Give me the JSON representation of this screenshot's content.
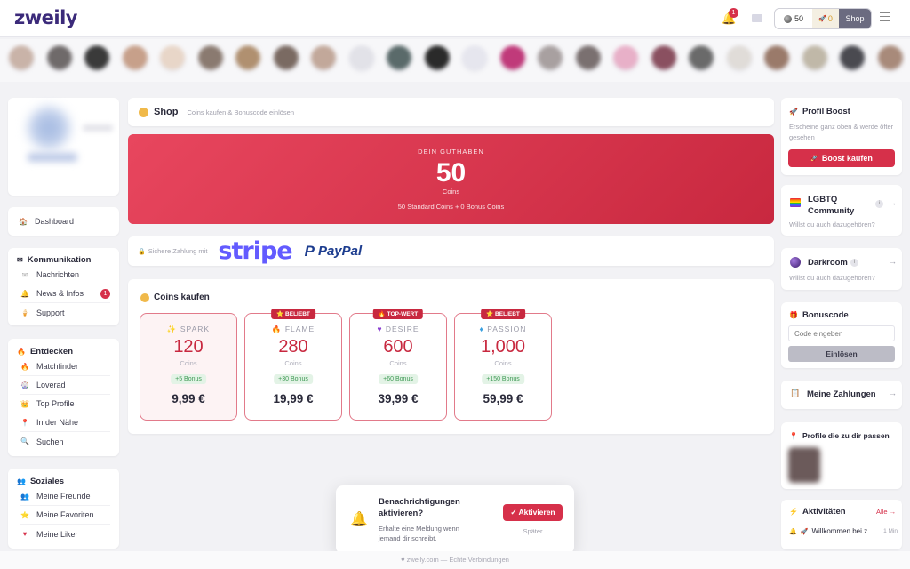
{
  "header": {
    "logo": "zweily",
    "notifications_count": "1",
    "coins": "50",
    "bonus_coins": "0",
    "shop_label": "Shop"
  },
  "left": {
    "dashboard": "Dashboard",
    "kommunikation": {
      "title": "Kommunikation",
      "items": [
        {
          "label": "Nachrichten",
          "icon": "envelope-icon"
        },
        {
          "label": "News & Infos",
          "icon": "bell-icon",
          "badge": "1"
        },
        {
          "label": "Support",
          "icon": "support-icon"
        }
      ]
    },
    "entdecken": {
      "title": "Entdecken",
      "items": [
        {
          "label": "Matchfinder",
          "icon": "flame-icon"
        },
        {
          "label": "Loverad",
          "icon": "wheel-icon"
        },
        {
          "label": "Top Profile",
          "icon": "crown-icon"
        },
        {
          "label": "In der Nähe",
          "icon": "pin-icon"
        },
        {
          "label": "Suchen",
          "icon": "search-icon"
        }
      ]
    },
    "soziales": {
      "title": "Soziales",
      "items": [
        {
          "label": "Meine Freunde",
          "icon": "friends-icon"
        },
        {
          "label": "Meine Favoriten",
          "icon": "star-icon"
        },
        {
          "label": "Meine Liker",
          "icon": "heart-icon"
        }
      ]
    }
  },
  "shop": {
    "title": "Shop",
    "subtitle": "Coins kaufen & Bonuscode einlösen",
    "balance_label": "DEIN GUTHABEN",
    "balance_value": "50",
    "balance_unit": "Coins",
    "balance_detail": "50 Standard Coins + 0 Bonus Coins",
    "secure_payment": "Sichere Zahlung mit",
    "stripe": "stripe",
    "paypal": "PayPal",
    "buy_title": "Coins kaufen",
    "packages": [
      {
        "ribbon": "",
        "name": "SPARK",
        "amount": "120",
        "unit": "Coins",
        "bonus": "+5 Bonus",
        "price": "9,99 €"
      },
      {
        "ribbon": "BELIEBT",
        "name": "FLAME",
        "amount": "280",
        "unit": "Coins",
        "bonus": "+30 Bonus",
        "price": "19,99 €"
      },
      {
        "ribbon": "TOP-WERT",
        "name": "DESIRE",
        "amount": "600",
        "unit": "Coins",
        "bonus": "+60 Bonus",
        "price": "39,99 €"
      },
      {
        "ribbon": "BELIEBT",
        "name": "PASSION",
        "amount": "1,000",
        "unit": "Coins",
        "bonus": "+150 Bonus",
        "price": "59,99 €"
      }
    ]
  },
  "right": {
    "boost": {
      "title": "Profil Boost",
      "desc": "Erscheine ganz oben & werde öfter gesehen",
      "button": "Boost kaufen"
    },
    "lgbtq": {
      "title": "LGBTQ Community",
      "desc": "Willst du auch dazugehören?"
    },
    "darkroom": {
      "title": "Darkroom",
      "desc": "Willst du auch dazugehören?"
    },
    "bonuscode": {
      "title": "Bonuscode",
      "placeholder": "Code eingeben",
      "button": "Einlösen"
    },
    "payments": {
      "title": "Meine Zahlungen"
    },
    "matches": {
      "title": "Profile die zu dir passen"
    },
    "activity": {
      "title": "Aktivitäten",
      "all": "Alle →",
      "item": "Willkommen bei z...",
      "time": "1 Min"
    }
  },
  "toast": {
    "title": "Benachrichtigungen aktivieren?",
    "desc": "Erhalte eine Meldung wenn jemand dir schreibt.",
    "activate": "✓ Aktivieren",
    "later": "Später"
  },
  "footer": "♥ zweily.com — Echte Verbindungen"
}
